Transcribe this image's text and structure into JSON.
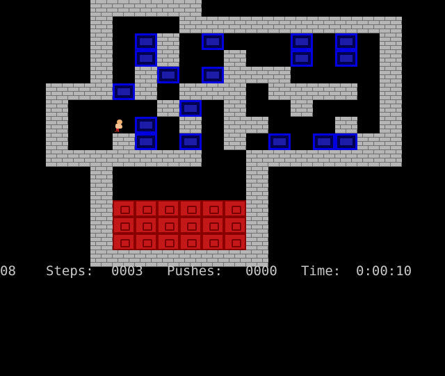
{
  "game": "sokoban",
  "colors": {
    "background": "#000000",
    "wall": "#b6b6b6",
    "box": "#0000e0",
    "goal": "#c41818",
    "text": "#c8c8c8"
  },
  "level": {
    "map": [
      "    #####           ",
      "    #   ##########  ",
      "    # $# $   $ $ #  ",
      "    # $#  #  $ $ #  ",
      "    # #$ $###    #  ",
      "  ###$# ### #### #  ",
      "  #    #$ #  #   #  ",
      "  #  @$ # ##   # #  ",
      "  #  #$ $ # $ $$##  ",
      "  #######  ####### ",
      "    #      #        ",
      "    #      #        ",
      "    #......#        ",
      "    #......#        ",
      "    #......#        ",
      "    ########        "
    ],
    "legend": {
      "#": "wall",
      "$": "box",
      ".": "goal",
      "@": "player",
      " ": "floor"
    }
  },
  "status": {
    "level_number": "08",
    "steps_label": "Steps:",
    "steps_value": "0003",
    "pushes_label": "Pushes:",
    "pushes_value": "0000",
    "time_label": "Time:",
    "time_value": "0:00:10"
  }
}
